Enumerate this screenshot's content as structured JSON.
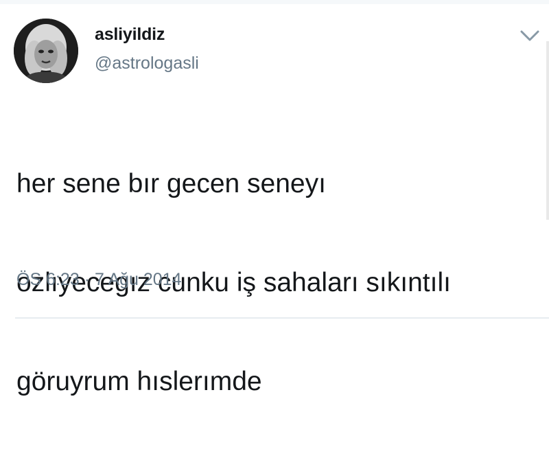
{
  "tweet": {
    "display_name": "asliyildiz",
    "handle": "@astrologasli",
    "text_lines": [
      "her sene bır gecen seneyı",
      "ozlıyecegız cunku iş sahaları sıkıntılı",
      "göruyrum hıslerımde"
    ],
    "time": "ÖS 6:23",
    "separator": "·",
    "date": "7 Ağu 2014",
    "avatar_icon": "profile-photo",
    "menu_icon": "chevron-down-icon"
  },
  "colors": {
    "text": "#14171a",
    "secondary": "#657786",
    "divider": "#e6ecf0",
    "background": "#ffffff"
  }
}
